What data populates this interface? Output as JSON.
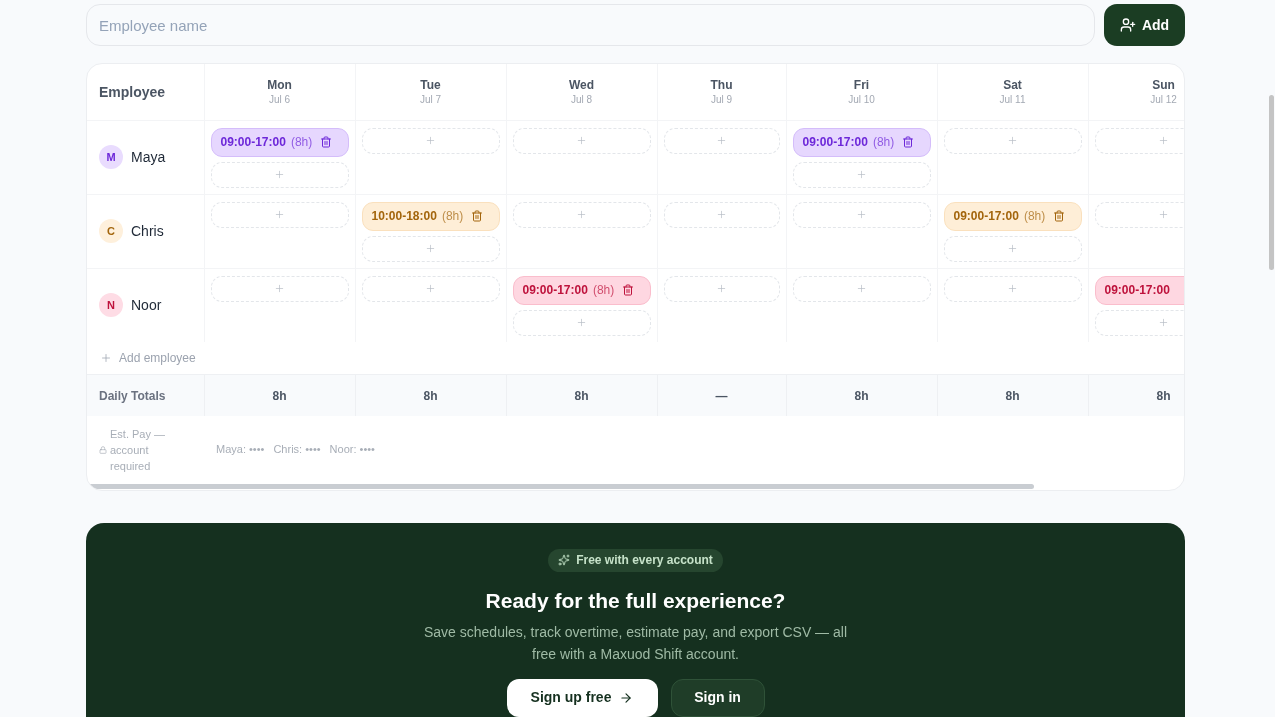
{
  "employee_input": {
    "placeholder": "Employee name"
  },
  "add_button": {
    "label": "Add"
  },
  "schedule": {
    "employee_header": "Employee",
    "days": [
      {
        "day": "Mon",
        "date": "Jul 6"
      },
      {
        "day": "Tue",
        "date": "Jul 7"
      },
      {
        "day": "Wed",
        "date": "Jul 8"
      },
      {
        "day": "Thu",
        "date": "Jul 9"
      },
      {
        "day": "Fri",
        "date": "Jul 10"
      },
      {
        "day": "Sat",
        "date": "Jul 11"
      },
      {
        "day": "Sun",
        "date": "Jul 12"
      }
    ],
    "employees": [
      {
        "initial": "M",
        "name": "Maya",
        "color": "#6d28d9",
        "cells": [
          {
            "kind": "shift",
            "time": "09:00-17:00",
            "hours": "(8h)"
          },
          {
            "kind": "empty"
          },
          {
            "kind": "empty"
          },
          {
            "kind": "empty"
          },
          {
            "kind": "shift",
            "time": "09:00-17:00",
            "hours": "(8h)"
          },
          {
            "kind": "empty"
          },
          {
            "kind": "empty"
          }
        ]
      },
      {
        "initial": "C",
        "name": "Chris",
        "color": "#a3650c",
        "cells": [
          {
            "kind": "empty"
          },
          {
            "kind": "shift",
            "time": "10:00-18:00",
            "hours": "(8h)"
          },
          {
            "kind": "empty"
          },
          {
            "kind": "empty"
          },
          {
            "kind": "empty"
          },
          {
            "kind": "shift",
            "time": "09:00-17:00",
            "hours": "(8h)"
          },
          {
            "kind": "empty"
          }
        ]
      },
      {
        "initial": "N",
        "name": "Noor",
        "color": "#be123c",
        "cells": [
          {
            "kind": "empty"
          },
          {
            "kind": "empty"
          },
          {
            "kind": "shift",
            "time": "09:00-17:00",
            "hours": "(8h)"
          },
          {
            "kind": "empty"
          },
          {
            "kind": "empty"
          },
          {
            "kind": "empty"
          },
          {
            "kind": "shift",
            "time": "09:00-17:00"
          }
        ]
      }
    ],
    "add_employee": "Add employee",
    "totals": {
      "label": "Daily Totals",
      "values": [
        "8h",
        "8h",
        "8h",
        "—",
        "8h",
        "8h",
        "8h"
      ]
    },
    "est_pay": {
      "label": "Est. Pay — account required",
      "items": [
        "Maya: ••••",
        "Chris: ••••",
        "Noor: ••••"
      ]
    }
  },
  "cta": {
    "badge": "Free with every account",
    "title": "Ready for the full experience?",
    "description": "Save schedules, track overtime, estimate pay, and export CSV — all free with a Maxuod Shift account.",
    "buttons": [
      {
        "label": "Sign up free",
        "kind": "primary"
      },
      {
        "label": "Sign in",
        "kind": "secondary"
      }
    ]
  }
}
